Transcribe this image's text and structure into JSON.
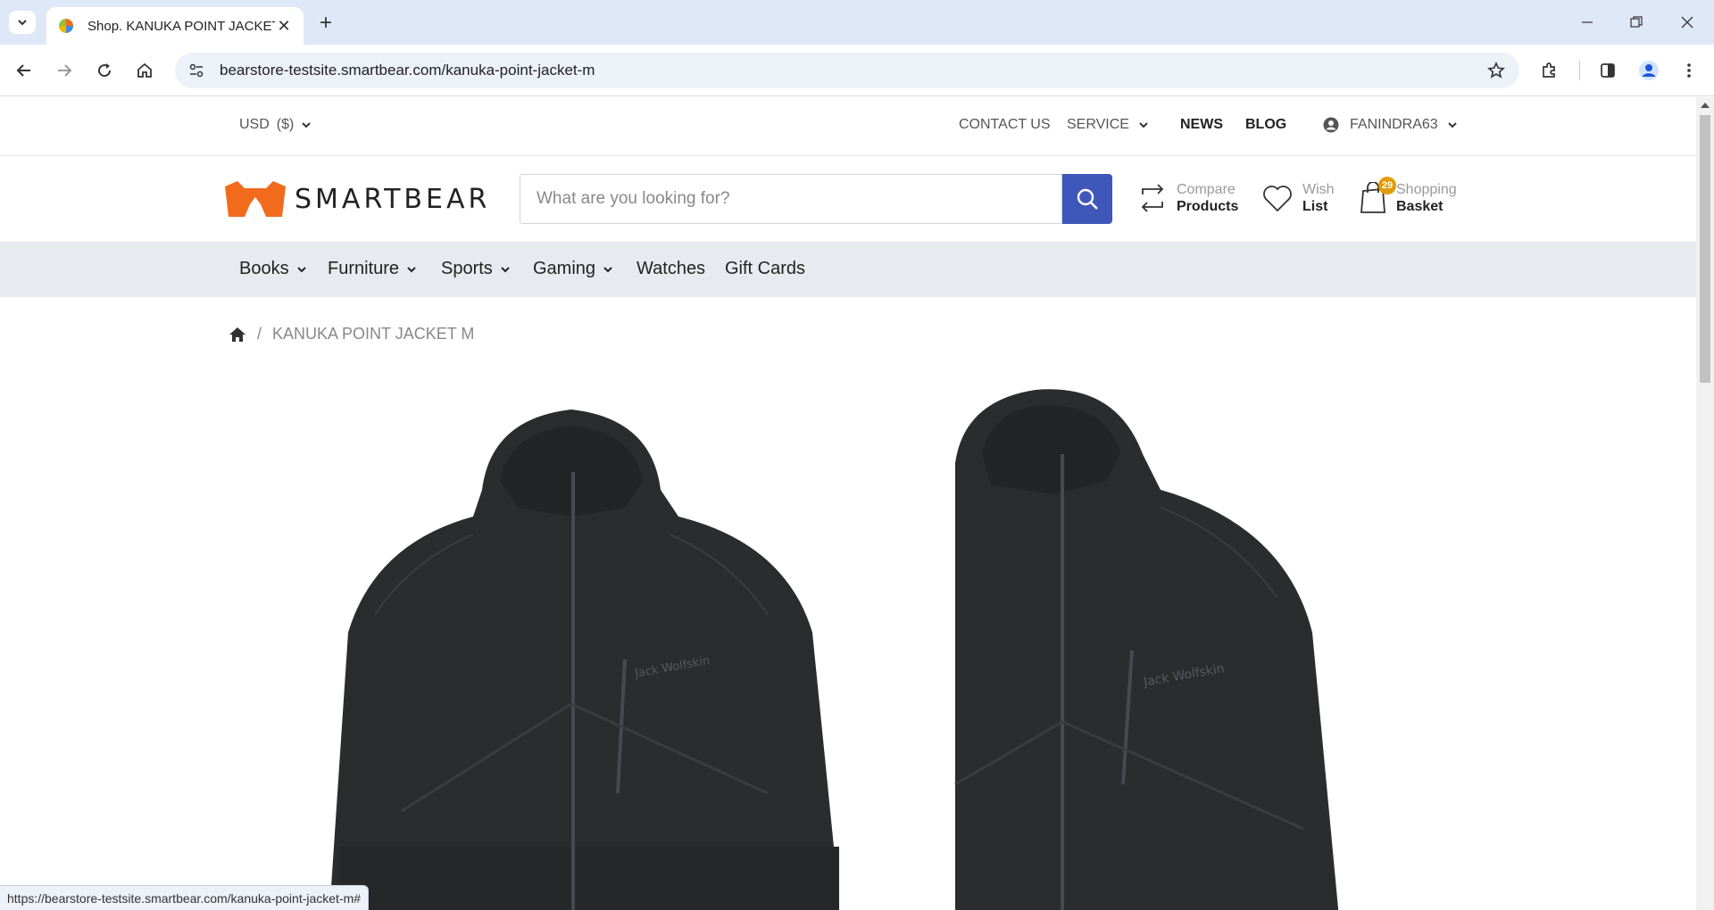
{
  "browser": {
    "tab_title": "Shop. KANUKA POINT JACKET M",
    "url": "bearstore-testsite.smartbear.com/kanuka-point-jacket-m",
    "status_url": "https://bearstore-testsite.smartbear.com/kanuka-point-jacket-m#"
  },
  "topbar": {
    "currency": "USD",
    "currency_symbol": "($)",
    "contact": "CONTACT US",
    "service": "SERVICE",
    "news": "NEWS",
    "blog": "BLOG",
    "user": "FANINDRA63"
  },
  "header": {
    "logo_text": "SMARTBEAR",
    "search_placeholder": "What are you looking for?",
    "compare_l1": "Compare",
    "compare_l2": "Products",
    "wish_l1": "Wish",
    "wish_l2": "List",
    "basket_l1": "Shopping",
    "basket_l2": "Basket",
    "basket_count": "29"
  },
  "categories": [
    {
      "label": "Books"
    },
    {
      "label": "Furniture"
    },
    {
      "label": "Sports"
    },
    {
      "label": "Gaming"
    },
    {
      "label": "Watches"
    },
    {
      "label": "Gift Cards"
    }
  ],
  "breadcrumb": {
    "current": "KANUKA POINT JACKET M"
  },
  "product": {
    "jacket_logo_text": "Jack Wolfskin"
  },
  "colors": {
    "brand_orange": "#f26b1d",
    "search_button": "#3f57b8",
    "badge": "#e39b0b",
    "nav_bg": "#e7eaee",
    "jacket": "#2b2c2e"
  }
}
